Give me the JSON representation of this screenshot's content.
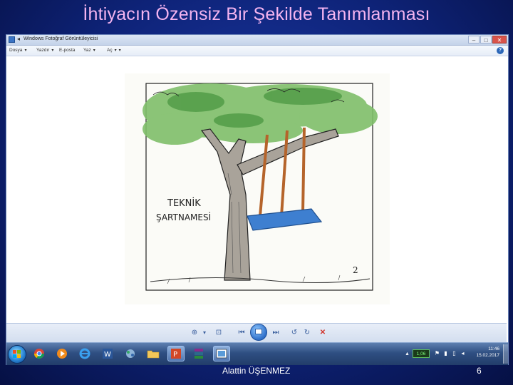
{
  "slide": {
    "title": "İhtiyacın Özensiz Bir Şekilde Tanımlanması",
    "author": "Alattin ÜŞENMEZ",
    "page_number": "6"
  },
  "window": {
    "title": "Windows Fotoğraf Görüntüleyicisi",
    "buttons": [
      "–",
      "□",
      "✕"
    ],
    "menu": [
      {
        "label": "Dosya"
      },
      {
        "label": "Yazdır"
      },
      {
        "label": "E-posta"
      },
      {
        "label": "Yaz"
      },
      {
        "label": "Aç"
      }
    ],
    "help_icon": "help-icon"
  },
  "photo": {
    "sign_line1": "TEKNİK",
    "sign_line2": "ŞARTNAMESİ",
    "artist_initial": "2"
  },
  "taskbar": {
    "apps": [
      "windows-start-icon",
      "chrome-icon",
      "media-player-icon",
      "internet-explorer-icon",
      "word-icon",
      "network-icon",
      "folder-icon",
      "powerpoint-icon",
      "winrar-icon",
      "photo-viewer-icon"
    ],
    "tray_badge": "1,06",
    "clock_time": "11:46",
    "clock_date": "15.02.2017"
  },
  "colors": {
    "title": "#f4b4f0",
    "background": "#0e2378",
    "swing_seat": "#3e7fd0"
  }
}
